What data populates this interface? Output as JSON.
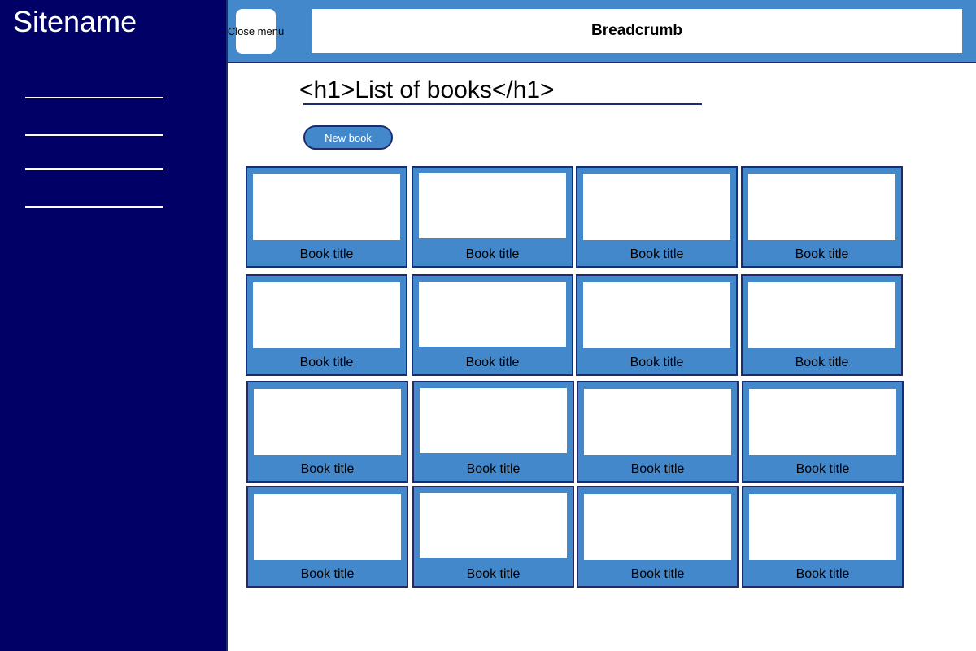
{
  "sidebar": {
    "site_name": "Sitename",
    "nav_items": [
      "",
      "",
      "",
      ""
    ]
  },
  "header": {
    "close_menu_label": "Close menu",
    "breadcrumb": "Breadcrumb"
  },
  "main": {
    "title": "<h1>List of books</h1>",
    "new_book_label": "New book",
    "books": [
      "Book title",
      "Book title",
      "Book title",
      "Book title",
      "Book title",
      "Book title",
      "Book title",
      "Book title",
      "Book title",
      "Book title",
      "Book title",
      "Book title",
      "Book title",
      "Book title",
      "Book title",
      "Book title"
    ]
  },
  "colors": {
    "sidebar_bg": "#000066",
    "accent": "#4488cc",
    "border": "#1c2c6e"
  }
}
